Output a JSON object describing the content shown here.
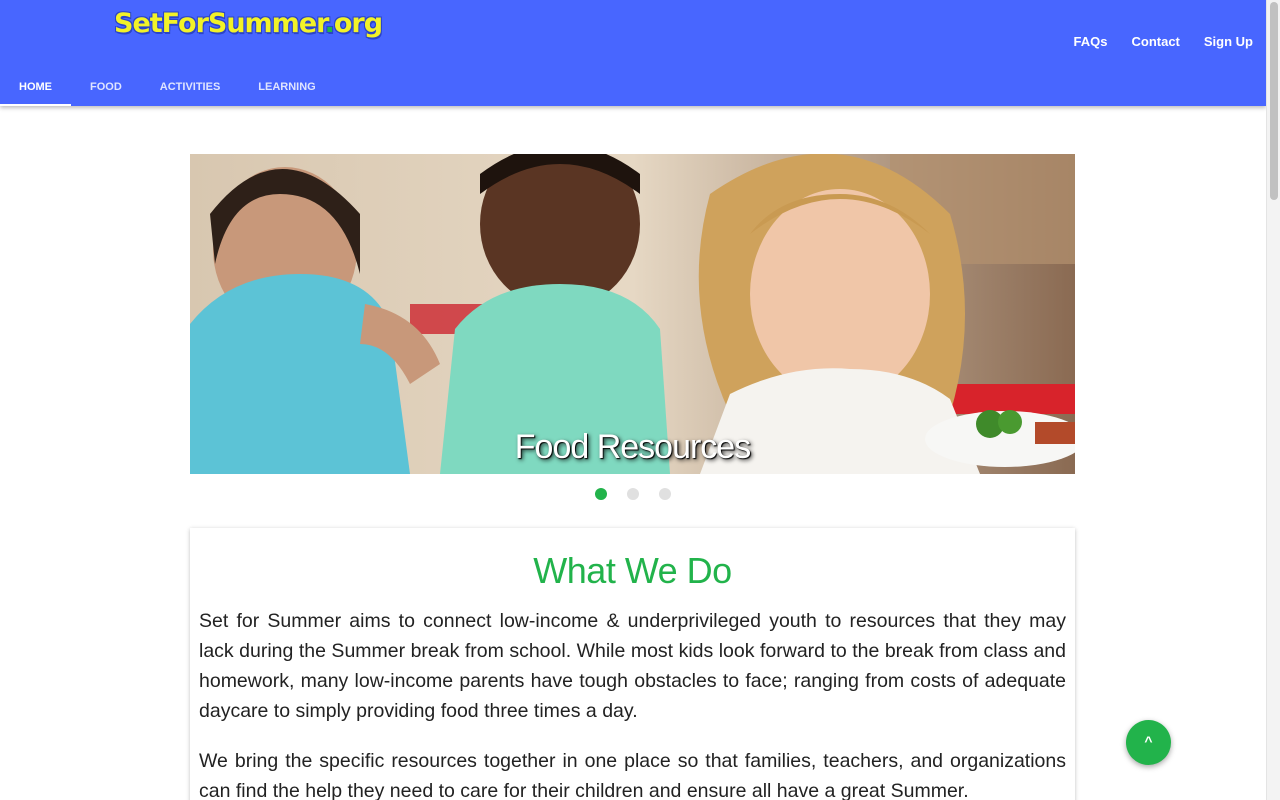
{
  "header": {
    "logo": {
      "text_main": "SetForSummer",
      "text_dot": ".",
      "text_tld": "org"
    },
    "top_links": [
      "FAQs",
      "Contact",
      "Sign Up"
    ],
    "nav": [
      "HOME",
      "FOOD",
      "ACTIVITIES",
      "LEARNING"
    ],
    "active_nav": "HOME"
  },
  "carousel": {
    "caption": "Food Resources",
    "slide_count": 3,
    "active_index": 0
  },
  "about": {
    "title": "What We Do",
    "paragraphs": [
      "Set for Summer aims to connect low-income & underprivileged youth to resources that they may lack during the Summer break from school. While most kids look forward to the break from class and homework, many low-income parents have tough obstacles to face; ranging from costs of adequate daycare to simply providing food three times a day.",
      "We bring the specific resources together in one place so that families, teachers, and organizations can find the help they need to care for their children and ensure all have a great Summer."
    ]
  },
  "fab": {
    "icon": "chevron-up-icon",
    "glyph": "^"
  },
  "colors": {
    "header": "#4866ff",
    "accent": "#22b34b",
    "logo": "#f2f228"
  }
}
